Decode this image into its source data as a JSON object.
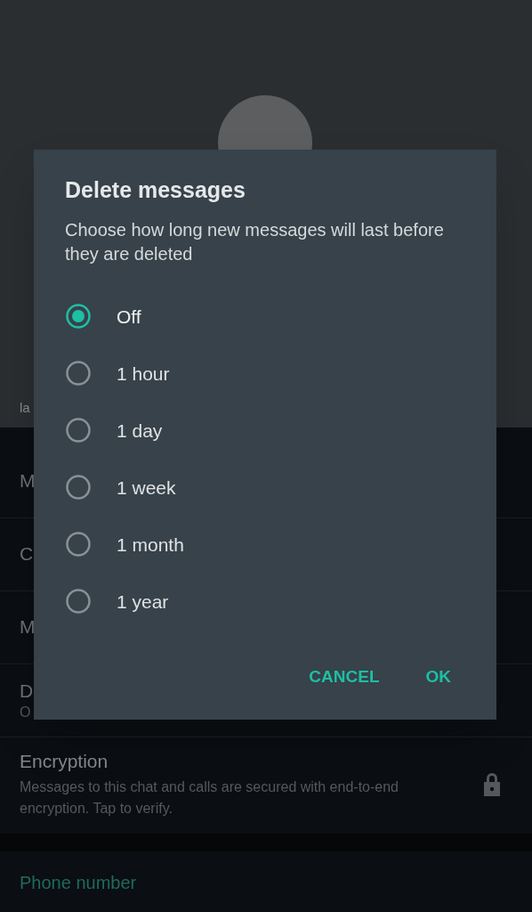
{
  "background": {
    "subtitle": "la",
    "rows": [
      {
        "label": "M"
      },
      {
        "label": "C"
      },
      {
        "label": "M"
      },
      {
        "label": "D",
        "value": "O"
      }
    ],
    "encryption": {
      "title": "Encryption",
      "description": "Messages to this chat and calls are secured with end-to-end encryption. Tap to verify."
    },
    "phone_section": {
      "title": "Phone number"
    }
  },
  "dialog": {
    "title": "Delete messages",
    "description": "Choose how long new messages will last before they are deleted",
    "options": [
      {
        "label": "Off",
        "selected": true
      },
      {
        "label": "1 hour",
        "selected": false
      },
      {
        "label": "1 day",
        "selected": false
      },
      {
        "label": "1 week",
        "selected": false
      },
      {
        "label": "1 month",
        "selected": false
      },
      {
        "label": "1 year",
        "selected": false
      }
    ],
    "buttons": [
      "CANCEL",
      "OK"
    ]
  }
}
